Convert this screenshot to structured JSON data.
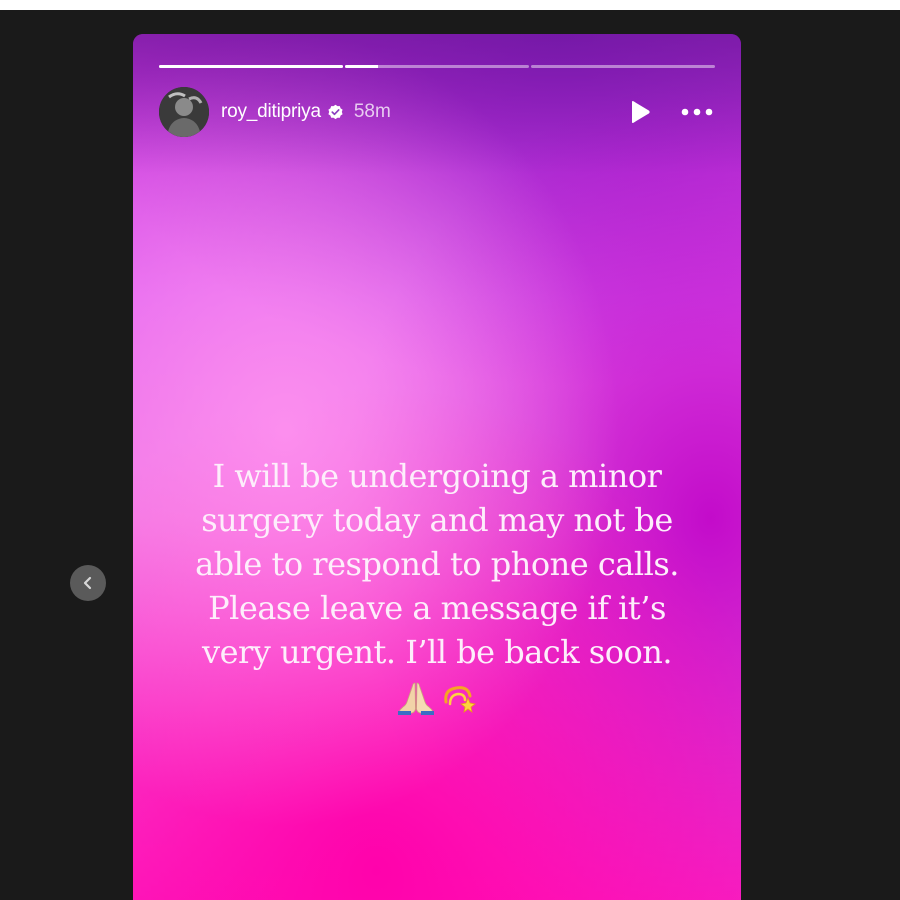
{
  "story": {
    "progress": [
      1.0,
      0.18,
      0.0
    ],
    "user": {
      "username": "roy_ditipriya",
      "verified": true,
      "timestamp": "58m",
      "avatar_icon": "profile-photo"
    },
    "controls": {
      "play_icon": "play-icon",
      "more_icon": "more-horizontal-icon"
    },
    "message_lines": [
      "I will be undergoing a minor",
      "surgery today and may not be",
      "able to respond to phone calls.",
      "Please leave a message if it’s",
      "very urgent. I’ll be back soon."
    ],
    "emojis": [
      "🙏",
      "💫"
    ]
  },
  "navigation": {
    "prev_icon": "chevron-left-icon"
  },
  "colors": {
    "viewer_background": "#1a1a1a",
    "gradient_top": "#c42fd6",
    "gradient_bottom": "#ff20c0",
    "text": "#fdeefb"
  }
}
